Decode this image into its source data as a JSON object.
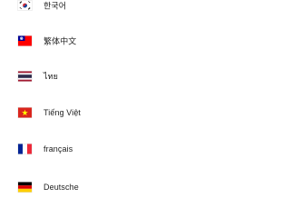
{
  "languages": [
    {
      "label": "한국어",
      "flag": "south-korea-flag-icon",
      "colors": [
        "#ffffff",
        "#cd2e3a",
        "#0047a0",
        "#000000"
      ]
    },
    {
      "label": "繁体中文",
      "flag": "taiwan-flag-icon",
      "colors": [
        "#fe0000",
        "#000095",
        "#ffffff"
      ]
    },
    {
      "label": "ไทย",
      "flag": "thailand-flag-icon",
      "colors": [
        "#a51931",
        "#f4f5f8",
        "#2d2a4a"
      ]
    },
    {
      "label": "Tiếng Việt",
      "flag": "vietnam-flag-icon",
      "colors": [
        "#da251d",
        "#ffff00"
      ]
    },
    {
      "label": "français",
      "flag": "france-flag-icon",
      "colors": [
        "#002395",
        "#ffffff",
        "#ed2939"
      ]
    },
    {
      "label": "Deutsche",
      "flag": "germany-flag-icon",
      "colors": [
        "#000000",
        "#dd0000",
        "#ffce00"
      ]
    }
  ]
}
